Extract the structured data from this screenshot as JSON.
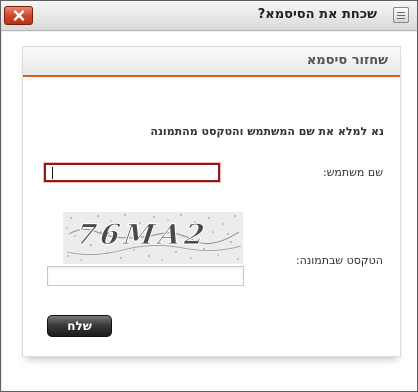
{
  "window": {
    "title": "שכחת את הסיסמא?"
  },
  "panel": {
    "title": "שחזור סיסמא",
    "instruction": "נא למלא את שם המשתמש והטקסט מהתמונה"
  },
  "form": {
    "username_label": "שם משתמש:",
    "username_value": "",
    "captcha_label": "הטקסט שבתמונה:",
    "captcha_value": "",
    "submit_label": "שלח"
  },
  "captcha": {
    "text": "76MA2"
  },
  "colors": {
    "accent": "#e15a1a",
    "close_button": "#d0462b",
    "focus_border": "#8b1a1a"
  },
  "icons": {
    "close": "close-icon",
    "window": "window-icon"
  }
}
